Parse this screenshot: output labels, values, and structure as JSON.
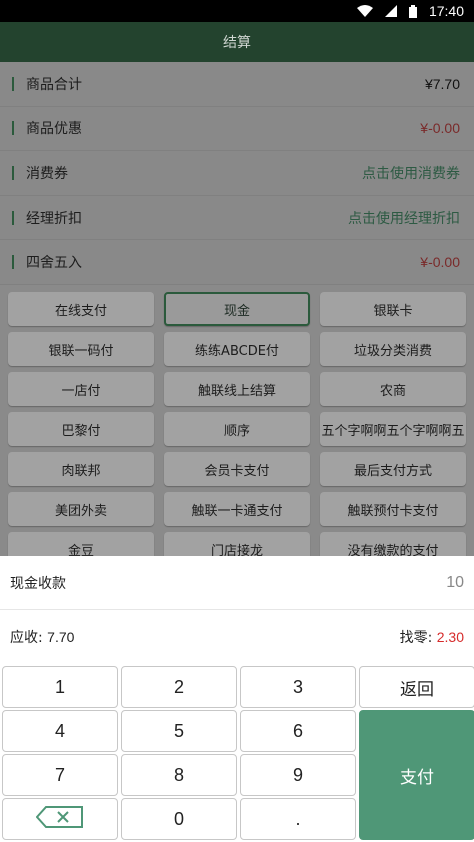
{
  "status_bar": {
    "time": "17:40"
  },
  "header": {
    "title": "结算"
  },
  "summary": [
    {
      "label": "商品合计",
      "value": "¥7.70",
      "tone": "black"
    },
    {
      "label": "商品优惠",
      "value": "¥-0.00",
      "tone": "red"
    },
    {
      "label": "消费券",
      "value": "点击使用消费券",
      "tone": "green"
    },
    {
      "label": "经理折扣",
      "value": "点击使用经理折扣",
      "tone": "green"
    },
    {
      "label": "四舍五入",
      "value": "¥-0.00",
      "tone": "red"
    }
  ],
  "payment_methods": [
    "在线支付",
    "现金",
    "银联卡",
    "银联一码付",
    "练练ABCDE付",
    "垃圾分类消费",
    "一店付",
    "触联线上结算",
    "农商",
    "巴黎付",
    "顺序",
    "五个字啊啊五个字啊啊五",
    "肉联邦",
    "会员卡支付",
    "最后支付方式",
    "美团外卖",
    "触联一卡通支付",
    "触联预付卡支付",
    "金豆",
    "门店接龙",
    "没有缴款的支付"
  ],
  "selected_payment": "现金",
  "cash_sheet": {
    "title": "现金收款",
    "input_value": "10",
    "due_label": "应收:",
    "due_value": "7.70",
    "change_label": "找零:",
    "change_value": "2.30"
  },
  "keypad": {
    "keys": [
      "1",
      "2",
      "3",
      "4",
      "5",
      "6",
      "7",
      "8",
      "9",
      "0",
      "."
    ],
    "back_label": "返回",
    "pay_label": "支付"
  },
  "colors": {
    "accent": "#4f9777",
    "change": "#d62b2b",
    "header": "#23432e"
  }
}
